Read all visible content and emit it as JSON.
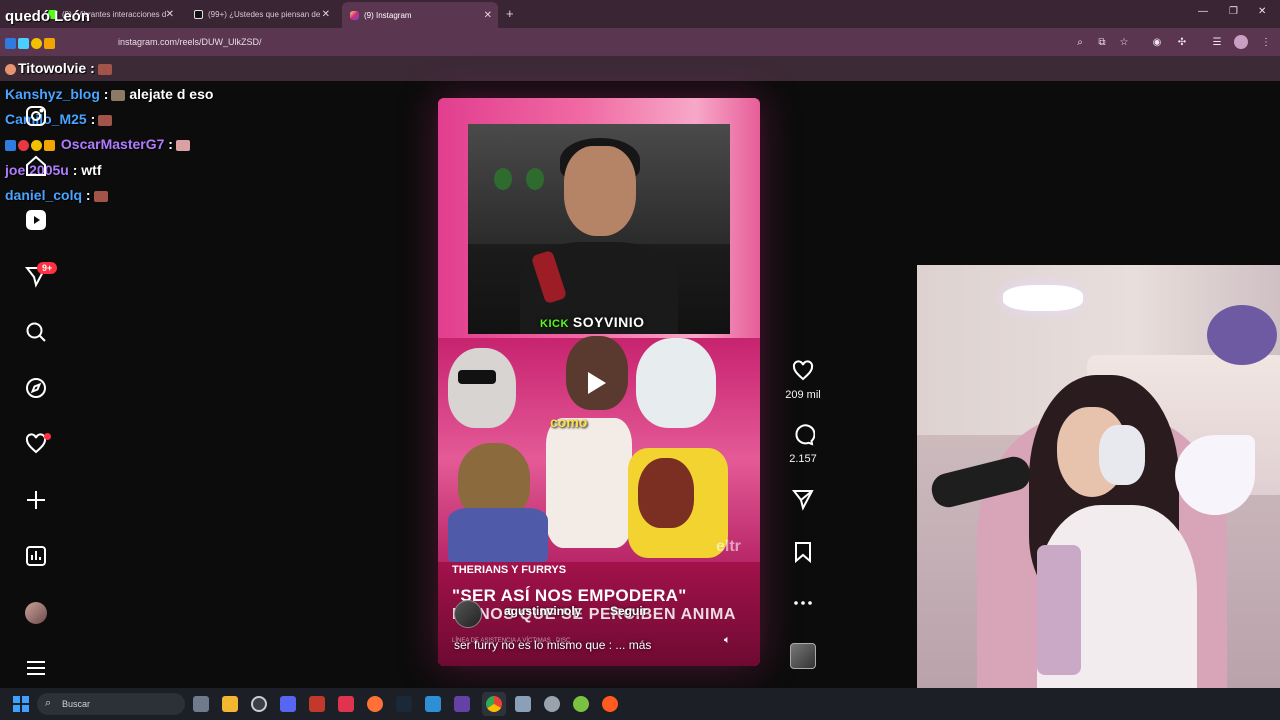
{
  "browser": {
    "tabs": [
      {
        "label": "(9) ¡Vibrantes interacciones d",
        "active": false
      },
      {
        "label": "(99+) ¿Ustedes que piensan de",
        "active": false
      },
      {
        "label": "(9) Instagram",
        "active": true
      }
    ],
    "url": "instagram.com/reels/DUW_UlkZSD/",
    "new_tab": "+"
  },
  "chat": {
    "top_overlay": "quedó León",
    "lines": [
      {
        "user": "Titowolvie",
        "sep": ":",
        "message": ""
      },
      {
        "user": "Kanshyz_blog",
        "sep": ":",
        "message": "alejate d eso"
      },
      {
        "user": "Camilo_M25",
        "sep": ":",
        "message": ""
      },
      {
        "user": "OscarMasterG7",
        "sep": ":",
        "message": ""
      },
      {
        "user": "joel2005u",
        "sep": ":",
        "message": "wtf"
      },
      {
        "user": "daniel_colq",
        "sep": ":",
        "message": ""
      }
    ],
    "colors": {
      "user": "#4aa3ff",
      "user_purple": "#b07cff",
      "user_white": "#ffffff"
    }
  },
  "sidebar": {
    "notifications_badge": "9+",
    "icons": [
      "instagram-icon",
      "home-icon",
      "reels-icon",
      "messages-icon",
      "search-icon",
      "explore-icon",
      "notifications-icon",
      "create-icon",
      "dashboard-icon",
      "profile-avatar",
      "menu-icon"
    ]
  },
  "reel": {
    "stream_label_prefix": "KICK",
    "stream_label": "SOYVINIO",
    "caption_word": "como",
    "watermark": "eltr",
    "tag_label": "THERIANS Y FURRYS",
    "headline": "\"SER ASÍ NOS EMPODERA\"",
    "headline2": "MANOS QUE SE PERCIBEN ANIMA",
    "ticker": "LÍNEA DE ASISTENCIA A VÍCTIMAS · DISC",
    "author": "agustinvinoly",
    "follow_label": "Seguir",
    "caption": "ser furry no es lo mismo que : ... más"
  },
  "actions": {
    "likes": "209 mil",
    "comments": "2.157"
  },
  "taskbar": {
    "search_placeholder": "Buscar"
  },
  "accent": "#ff3040"
}
